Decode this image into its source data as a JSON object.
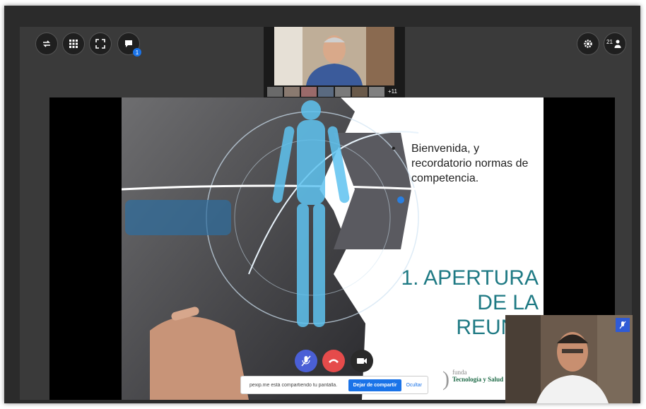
{
  "toolbar_left": {
    "buttons": [
      {
        "name": "switch-camera",
        "icon": "switch-icon"
      },
      {
        "name": "grid-view",
        "icon": "grid-icon"
      },
      {
        "name": "fullscreen",
        "icon": "expand-icon"
      },
      {
        "name": "chat",
        "icon": "chat-icon",
        "badge": "1"
      }
    ]
  },
  "toolbar_right": {
    "settings_icon": "gear-icon",
    "participants_count": "21"
  },
  "filmstrip": {
    "more_label": "+11"
  },
  "slide": {
    "bullet": "•",
    "bullet_text": "Bienvenida, y recordatorio normas de competencia.",
    "title_line1": "1. APERTURA",
    "title_line2": "DE LA",
    "title_line3": "REUNIÓ",
    "logo_top": "funda",
    "logo_bottom": "Tecnología y Salud"
  },
  "controls": {
    "mic_icon": "mic-off-icon",
    "hangup_icon": "phone-hangup-icon",
    "camera_icon": "video-icon"
  },
  "share_banner": {
    "message": "pexip.me está compartiendo tu pantalla.",
    "stop_label": "Dejar de compartir",
    "hide_label": "Ocultar"
  },
  "colors": {
    "accent": "#1a73e8",
    "title_teal": "#1f7a84",
    "hangup_red": "#e54b4b",
    "mic_blue": "#4a5fd6"
  }
}
